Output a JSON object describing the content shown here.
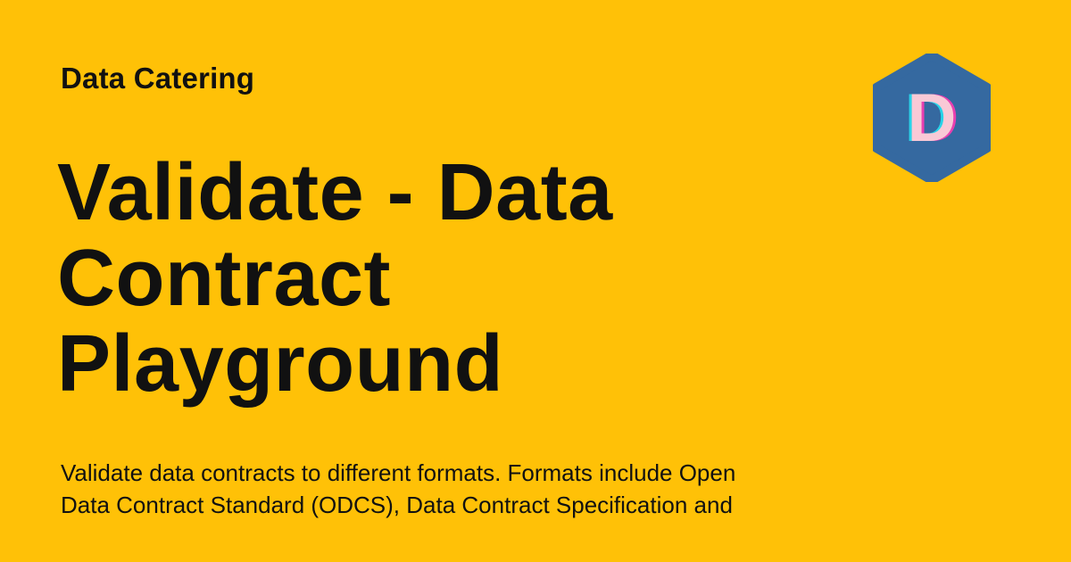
{
  "header": {
    "site_name": "Data Catering"
  },
  "main": {
    "title_lines": [
      "Validate - Data",
      "Contract",
      "Playground"
    ],
    "description_lines": [
      "Validate data contracts to different formats. Formats include Open",
      "Data Contract Standard (ODCS), Data Contract Specification and"
    ]
  },
  "logo": {
    "letter": "D",
    "icon": "hexagon-logo-icon"
  },
  "colors": {
    "background": "#FFC107",
    "text": "#111111",
    "logo_hex": "#3569A0",
    "logo_letter": "#F9C9D6",
    "logo_letter_shadow_magenta": "#E83FB0",
    "logo_letter_shadow_cyan": "#27D3E8"
  }
}
